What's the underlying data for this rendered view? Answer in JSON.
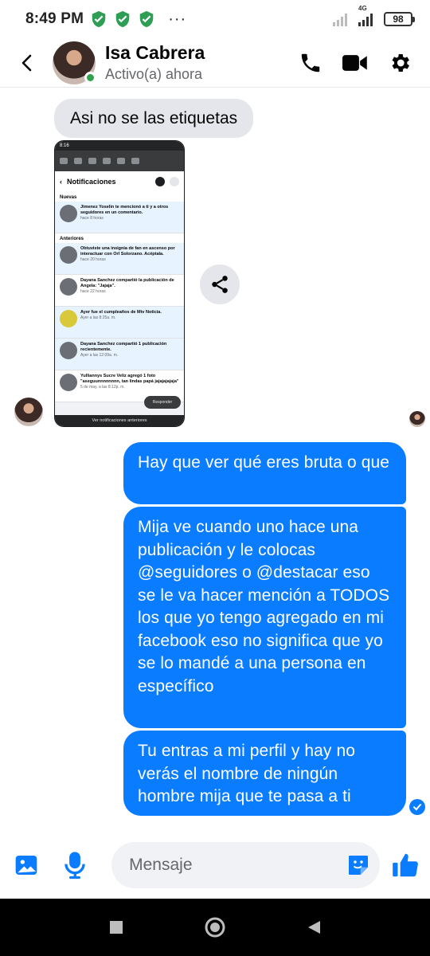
{
  "status_bar": {
    "time": "8:49 PM",
    "dots": "···",
    "network": "4G",
    "battery": "98",
    "icons": [
      "shield-check-icon",
      "shield-check-icon",
      "shield-check-icon",
      "signal-icon",
      "battery-icon"
    ]
  },
  "header": {
    "name": "Isa Cabrera",
    "status": "Activo(a) ahora",
    "icons": [
      "back-arrow-icon",
      "phone-icon",
      "video-icon",
      "gear-icon"
    ]
  },
  "messages": {
    "incoming_text": "Asi no se las etiquetas",
    "screenshot": {
      "time": "8:16",
      "title": "Notificaciones",
      "section_new": "Nuevas",
      "section_older": "Anteriores",
      "items": [
        {
          "text": "Jimenez Yoselin te mencionó a ti y a otros seguidores en un comentario.",
          "time": "hace 8 horas"
        },
        {
          "text": "Obtuviste una insignia de fan en ascenso por interactuar con Orl Solorzano. Acéptala.",
          "time": "hace 20 horas"
        },
        {
          "text": "Dayana Sanchez compartió la publicación de Angela: \"Jajaja\".",
          "time": "hace 22 horas"
        },
        {
          "text": "Ayer fue el cumpleaños de Mtv Noticia.",
          "time": "Ayer a las 8:25a. m."
        },
        {
          "text": "Dayana Sanchez compartió 1 publicación recientemente.",
          "time": "Ayer a las 12:09a. m."
        },
        {
          "text": "Yulliannys Sucre Veliz agregó 1 foto \"aseguunnnnnnnn, tan lindas papá jajajajajaja\"",
          "time": "5 de may. a las 8:12p. m."
        }
      ],
      "reply_label": "Responder",
      "footer": "Ver notificaciones anteriores"
    },
    "outgoing": [
      "Hay que ver qué eres bruta o que",
      "Mija ve cuando uno hace una publicación y le colocas @seguidores o @destacar eso se le va hacer mención a TODOS los que yo tengo agregado en mi facebook eso no significa que yo se lo mandé a una persona en específico",
      "Tu entras a mi perfil y hay no verás el nombre de ningún hombre mija que te pasa a ti"
    ]
  },
  "composer": {
    "placeholder": "Mensaje",
    "icons": [
      "image-icon",
      "microphone-icon",
      "sticker-icon",
      "thumbs-up-icon"
    ]
  },
  "colors": {
    "accent": "#0a7cff",
    "incoming_bubble": "#e4e6eb",
    "online": "#31a24c"
  }
}
